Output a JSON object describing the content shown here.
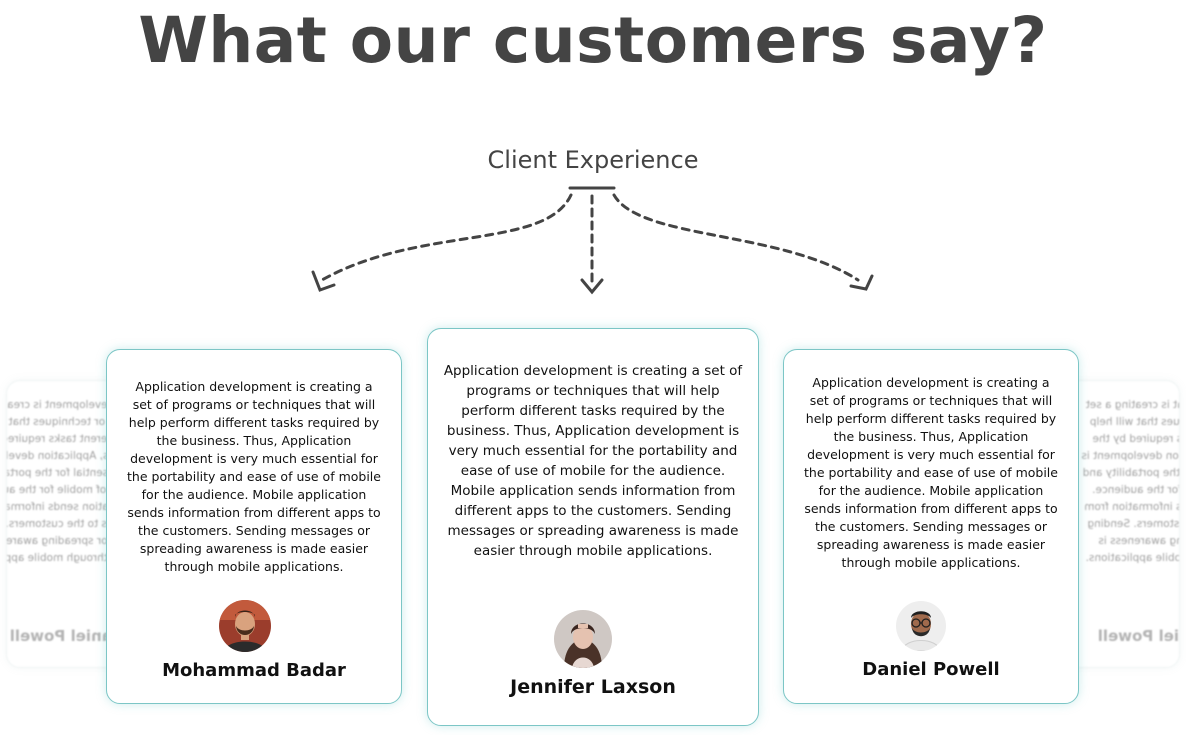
{
  "page": {
    "title": "What our customers say?",
    "section_label": "Client Experience"
  },
  "colors": {
    "title": "#444444",
    "card_border": "#7cc6c6",
    "arrow": "#444444"
  },
  "testimonials": [
    {
      "name": "Mohammad Badar",
      "avatar_icon": "avatar-mohammad",
      "quote": "Application development is creating a set of programs or techniques that will help perform different tasks required by the business. Thus, Application development is very much essential for the portability and ease of use of mobile for the audience. Mobile application sends information from different apps to the customers. Sending messages or spreading awareness is made easier through mobile applications."
    },
    {
      "name": "Jennifer Laxson",
      "avatar_icon": "avatar-jennifer",
      "quote": "Application development is creating a set of programs or techniques that will help perform different tasks required by the business. Thus, Application development is very much essential for the portability and ease of use of mobile for the audience. Mobile application sends information from different apps to the customers. Sending messages or spreading awareness is made easier through mobile applications."
    },
    {
      "name": "Daniel Powell",
      "avatar_icon": "avatar-daniel",
      "quote": "Application development is creating a set of programs or techniques that will help perform different tasks required by the business. Thus, Application development is very much essential for the portability and ease of use of mobile for the audience. Mobile application sends information from different apps to the customers. Sending messages or spreading awareness is made easier through mobile applications."
    }
  ],
  "ghost_cards": {
    "left": {
      "name": "Daniel Powell",
      "lines": [
        "Application development is creating a set",
        "of programs or techniques that will help",
        "perform different tasks required by the",
        "business. Thus, Application development is",
        "very much essential for the portability and",
        "ease of use of mobile for the audience.",
        "Mobile application sends information from",
        "different apps to the customers. Sending",
        "messages or spreading awareness is",
        "made easier through mobile applications."
      ]
    },
    "right": {
      "name": "Daniel Powell",
      "lines": [
        "Application development is creating a set",
        "of programs or techniques that will help",
        "perform different tasks required by the",
        "business. Thus, Application development is",
        "very much essential for the portability and",
        "ease of use of mobile for the audience.",
        "Mobile application sends information from",
        "different apps to the customers. Sending",
        "messages or spreading awareness is",
        "made easier through mobile applications."
      ]
    }
  }
}
